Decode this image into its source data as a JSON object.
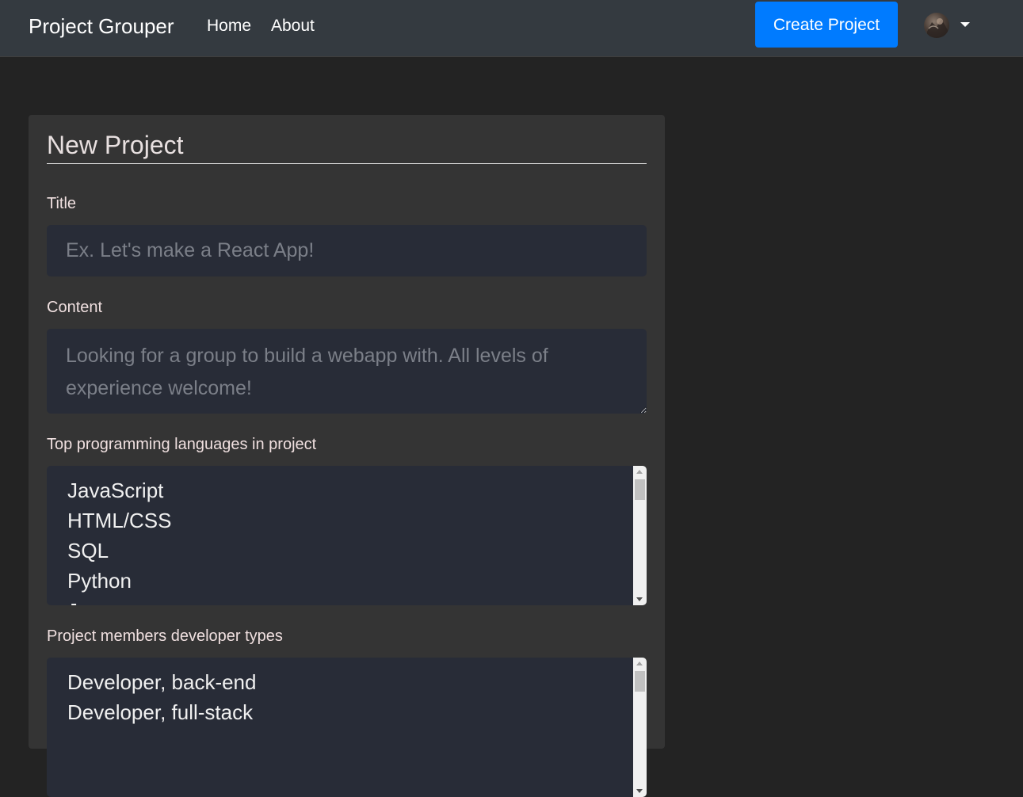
{
  "navbar": {
    "brand": "Project Grouper",
    "links": [
      "Home",
      "About"
    ],
    "create_button": "Create Project",
    "avatar_icon": "user-avatar-icon",
    "dropdown_icon": "caret-down-icon",
    "accent_color": "#007bff"
  },
  "form": {
    "heading": "New Project",
    "title_label": "Title",
    "title_placeholder": "Ex. Let's make a React App!",
    "title_value": "",
    "content_label": "Content",
    "content_placeholder": "Looking for a group to build a webapp with. All levels of experience welcome!",
    "content_value": "",
    "languages_label": "Top programming languages in project",
    "languages_options": [
      "JavaScript",
      "HTML/CSS",
      "SQL",
      "Python",
      "Java"
    ],
    "devtypes_label": "Project members developer types",
    "devtypes_options": [
      "Developer, back-end",
      "Developer, full-stack"
    ]
  }
}
